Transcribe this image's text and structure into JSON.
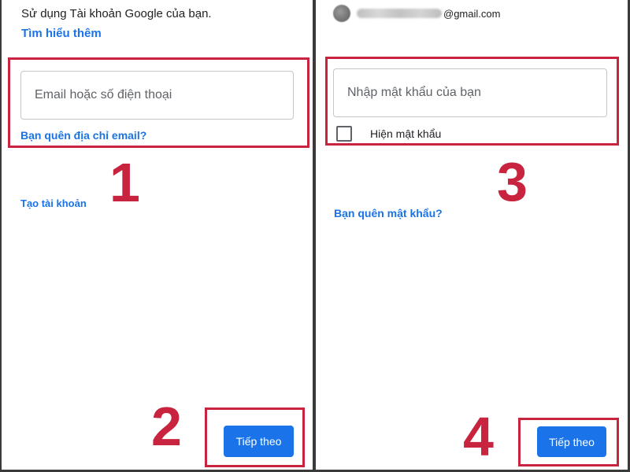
{
  "left_panel": {
    "intro_text": "Sử dụng Tài khoản Google của bạn.",
    "learn_more_link": "Tìm hiểu thêm",
    "email_input": {
      "placeholder": "Email hoặc số điện thoại",
      "value": ""
    },
    "forgot_email_link": "Bạn quên địa chỉ email?",
    "create_account_link": "Tạo tài khoản",
    "next_button": "Tiếp theo",
    "step_labels": [
      "1",
      "2"
    ]
  },
  "right_panel": {
    "account_email_suffix": "@gmail.com",
    "password_input": {
      "placeholder": "Nhập mật khẩu của bạn",
      "value": ""
    },
    "show_password_label": "Hiện mật khẩu",
    "show_password_checked": false,
    "forgot_password_link": "Bạn quên mật khẩu?",
    "next_button": "Tiếp theo",
    "step_labels": [
      "3",
      "4"
    ]
  },
  "colors": {
    "accent_blue": "#1a73e8",
    "highlight_red": "#c9243f",
    "divider": "#3a3a3a"
  }
}
